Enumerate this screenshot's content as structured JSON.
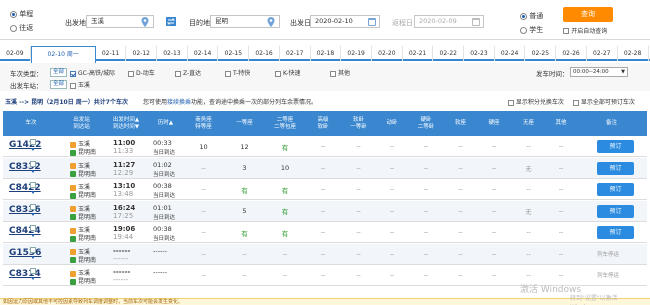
{
  "search": {
    "trip_oneway": "单程",
    "trip_round": "往返",
    "from_label": "出发地",
    "from_value": "玉溪",
    "to_label": "目的地",
    "to_value": "昆明",
    "depart_label": "出发日",
    "depart_value": "2020-02-10",
    "return_label": "返程日",
    "return_value": "2020-02-09",
    "type_normal": "普通",
    "type_student": "学生",
    "query_button": "查询",
    "auto_query": "开启自动查询"
  },
  "date_tabs": [
    "02-09",
    "02-10 周一",
    "02-11",
    "02-12",
    "02-13",
    "02-14",
    "02-15",
    "02-16",
    "02-17",
    "02-18",
    "02-19",
    "02-20",
    "02-21",
    "02-22",
    "02-23",
    "02-24",
    "02-25",
    "02-26",
    "02-27",
    "02-28"
  ],
  "filters": {
    "type_label": "车次类型：",
    "all_label": "全部",
    "types": [
      "GC-高铁/城际",
      "D-动车",
      "Z-直达",
      "T-特快",
      "K-快速",
      "其他"
    ],
    "station_label": "出发车站：",
    "station_all": "全部",
    "station_value": "玉溪",
    "time_label": "发车时间：",
    "time_value": "00:00--24:00"
  },
  "info": {
    "route": "玉溪 --> 昆明（2月10日  周一）共计7个车次",
    "hint_prefix": "您可使用",
    "hint_link": "接续换乘",
    "hint_suffix": "功能，查询途中换乘一次的部分列车余票情况。",
    "opt1": "显示积分兑换车次",
    "opt2": "显示全部可预订车次"
  },
  "table": {
    "headers": [
      "车次",
      "出发站\n到达站",
      "出发时间▲\n到达时间▼",
      "历时▲",
      "商务座\n特等座",
      "一等座",
      "二等座\n二等包座",
      "高级\n软卧",
      "软卧\n一等卧",
      "动卧",
      "硬卧\n二等卧",
      "软座",
      "硬座",
      "无座",
      "其他",
      "备注"
    ],
    "rows": [
      {
        "no": "G1422",
        "from": "玉溪",
        "to": "昆明南",
        "dep": "11:00",
        "arr": "11:33",
        "dur": "00:33",
        "day": "当日到达",
        "c": [
          "10",
          "12",
          "有",
          "--",
          "--",
          "--",
          "--",
          "--",
          "--",
          "--",
          "--"
        ],
        "book": "预订"
      },
      {
        "no": "C8332",
        "from": "玉溪",
        "to": "昆明南",
        "dep": "11:27",
        "arr": "12:29",
        "dur": "01:02",
        "day": "当日到达",
        "c": [
          "--",
          "3",
          "10",
          "--",
          "--",
          "--",
          "--",
          "--",
          "--",
          "无",
          "--"
        ],
        "book": "预订"
      },
      {
        "no": "C8422",
        "from": "玉溪",
        "to": "昆明南",
        "dep": "13:10",
        "arr": "13:48",
        "dur": "00:38",
        "day": "当日到达",
        "c": [
          "--",
          "有",
          "有",
          "--",
          "--",
          "--",
          "--",
          "--",
          "--",
          "--",
          "--"
        ],
        "book": "预订"
      },
      {
        "no": "C8336",
        "from": "玉溪",
        "to": "昆明南",
        "dep": "16:24",
        "arr": "17:25",
        "dur": "01:01",
        "day": "当日到达",
        "c": [
          "--",
          "5",
          "有",
          "--",
          "--",
          "--",
          "--",
          "--",
          "--",
          "无",
          "--"
        ],
        "book": "预订"
      },
      {
        "no": "C8424",
        "from": "玉溪",
        "to": "昆明南",
        "dep": "19:06",
        "arr": "19:44",
        "dur": "00:38",
        "day": "当日到达",
        "c": [
          "--",
          "有",
          "有",
          "--",
          "--",
          "--",
          "--",
          "--",
          "--",
          "--",
          "--"
        ],
        "book": "预订"
      },
      {
        "no": "G1536",
        "from": "玉溪",
        "to": "昆明南",
        "dep": "------",
        "arr": "------",
        "dur": "------",
        "day": "",
        "c": [
          "--",
          "--",
          "--",
          "--",
          "--",
          "--",
          "--",
          "--",
          "--",
          "--",
          "--"
        ],
        "book": "",
        "status": "列车停运"
      },
      {
        "no": "C8314",
        "from": "玉溪",
        "to": "昆明南",
        "dep": "------",
        "arr": "------",
        "dur": "------",
        "day": "",
        "c": [
          "--",
          "--",
          "--",
          "--",
          "--",
          "--",
          "--",
          "--",
          "--",
          "--",
          "--"
        ],
        "book": "",
        "status": "列车停运"
      }
    ]
  },
  "footer": "如因运力原因或其他不可控因素导致列车调度调整时，当前车次可能会发生变化。",
  "watermark": "激活 Windows",
  "watermark_sub": "转到\"设置\"以激活 Windows。"
}
